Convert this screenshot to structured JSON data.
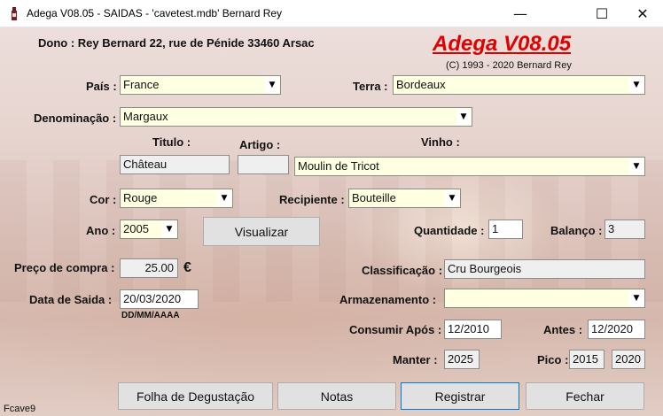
{
  "window": {
    "title": "Adega V08.05 - SAIDAS - 'cavetest.mdb'  Bernard Rey",
    "minimize_glyph": "—",
    "maximize_glyph": "☐",
    "close_glyph": "✕",
    "icon": "wine-bottle-icon"
  },
  "header": {
    "owner": "Dono : Rey Bernard 22, rue de Pénide 33460 Arsac",
    "brand": "Adega V08.05",
    "copyright": "(C) 1993 - 2020 Bernard Rey"
  },
  "form": {
    "pais": {
      "label": "País :",
      "value": "France"
    },
    "terra": {
      "label": "Terra :",
      "value": "Bordeaux"
    },
    "denominacao": {
      "label": "Denominação :",
      "value": "Margaux"
    },
    "titulo": {
      "label": "Titulo :",
      "value": "Château"
    },
    "artigo": {
      "label": "Artigo :",
      "value": ""
    },
    "vinho": {
      "label": "Vinho :",
      "value": "Moulin de Tricot"
    },
    "cor": {
      "label": "Cor :",
      "value": "Rouge"
    },
    "recipiente": {
      "label": "Recipiente :",
      "value": "Bouteille"
    },
    "ano": {
      "label": "Ano :",
      "value": "2005"
    },
    "quantidade": {
      "label": "Quantidade :",
      "value": "1"
    },
    "balanco": {
      "label": "Balanço :",
      "value": "3"
    },
    "preco": {
      "label": "Preço de compra :",
      "value": "25.00",
      "currency": "€"
    },
    "classificacao": {
      "label": "Classificação :",
      "value": "Cru Bourgeois"
    },
    "data_saida": {
      "label": "Data de Saida :",
      "value": "20/03/2020",
      "hint": "DD/MM/AAAA"
    },
    "armazenamento": {
      "label": "Armazenamento :",
      "value": ""
    },
    "consumir_apos": {
      "label": "Consumir Após :",
      "value": "12/2010"
    },
    "antes": {
      "label": "Antes :",
      "value": "12/2020"
    },
    "manter": {
      "label": "Manter :",
      "value": "2025"
    },
    "pico": {
      "label": "Pico :",
      "value_from": "2015",
      "value_to": "2020"
    }
  },
  "buttons": {
    "visualizar": "Visualizar",
    "folha": "Folha de Degustação",
    "notas": "Notas",
    "registrar": "Registrar",
    "fechar": "Fechar"
  },
  "status": {
    "form_name": "Fcave9"
  },
  "colors": {
    "brand": "#e00000",
    "field_yellow": "#ffffe1",
    "field_grey": "#efefef"
  }
}
